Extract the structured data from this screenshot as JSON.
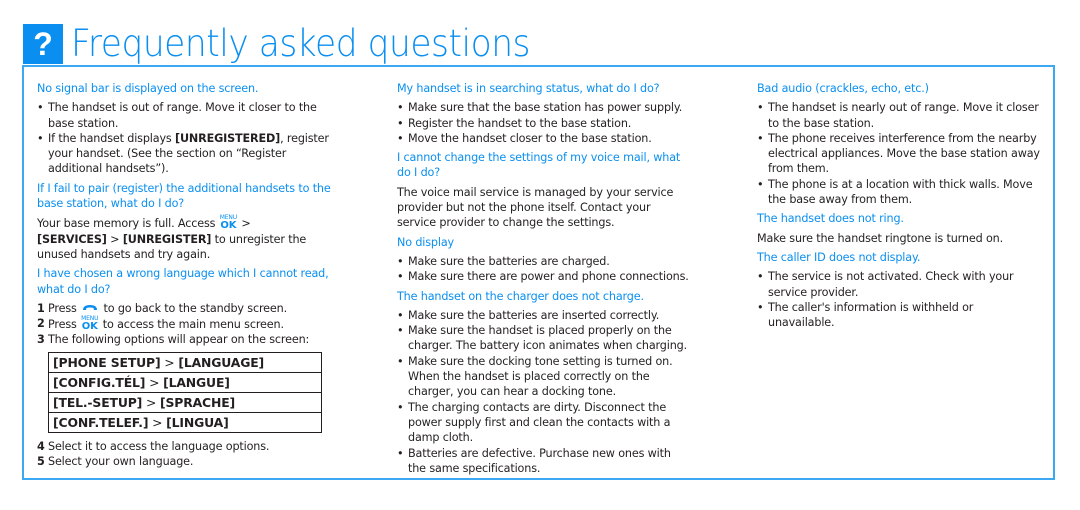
{
  "header": {
    "icon": "question-mark-icon",
    "icon_glyph": "?",
    "title": "Frequently asked questions",
    "accent_color": "#0a8ff0"
  },
  "col1": {
    "q1": {
      "question": "No signal bar is displayed on the screen.",
      "bullets": [
        "The handset is out of range. Move it closer to the base station.",
        {
          "pre": "If the handset displays ",
          "bold": "[UNREGISTERED]",
          "post": ", register your handset. (See the section on “Register additional handsets”)."
        }
      ]
    },
    "q2": {
      "question": "If I fail to pair (register) the additional handsets to the base station, what do I do?",
      "answer_pre": "Your base memory is full. Access ",
      "menu_top": "MENU",
      "menu_ok": "OK",
      "gt1": " > ",
      "bold1": "[SERVICES]",
      "gt2": " > ",
      "bold2": "[UNREGISTER]",
      "answer_post": " to unregister the unused handsets and try again."
    },
    "q3": {
      "question": "I have chosen a wrong language which I cannot read, what do I do?",
      "steps": [
        {
          "num": "1",
          "pre": "Press ",
          "icon": "end-call-icon",
          "post": " to go back to the standby screen."
        },
        {
          "num": "2",
          "pre": "Press ",
          "icon": "menu-ok-icon",
          "post": " to access the main menu screen."
        },
        {
          "num": "3",
          "text": "The following options will appear on the screen:"
        }
      ],
      "options": [
        {
          "a": "[PHONE SETUP]",
          "sep": " > ",
          "b": "[LANGUAGE]"
        },
        {
          "a": "[CONFIG.TÉL]",
          "sep": " > ",
          "b": "[LANGUE]"
        },
        {
          "a": "[TEL.-SETUP]",
          "sep": " > ",
          "b": "[SPRACHE]"
        },
        {
          "a": "[CONF.TELEF.]",
          "sep": " > ",
          "b": "[LINGUA]"
        }
      ],
      "steps_after": [
        {
          "num": "4",
          "text": "Select it to access the language options."
        },
        {
          "num": "5",
          "text": "Select your own language."
        }
      ]
    }
  },
  "col2": {
    "q1": {
      "question": "My handset is in searching status, what do I do?",
      "bullets": [
        "Make sure that the base station has power supply.",
        "Register the handset to the base station.",
        "Move the handset closer to the base station."
      ]
    },
    "q2": {
      "question": "I cannot change the settings of my voice mail, what do I do?",
      "answer": "The voice mail service is managed by your service provider but not the phone itself. Contact your service provider to change the settings."
    },
    "q3": {
      "question": "No display",
      "bullets": [
        "Make sure the batteries are charged.",
        "Make sure there are power and phone connections."
      ]
    },
    "q4": {
      "question": "The handset on the charger does not charge.",
      "bullets": [
        "Make sure the batteries are inserted correctly.",
        "Make sure the handset is placed properly on the charger. The battery icon animates when charging.",
        "Make sure the docking tone setting is turned on. When the handset is placed correctly on the charger, you can hear a docking tone.",
        "The charging contacts are dirty. Disconnect the power supply first and clean the contacts with a damp cloth.",
        "Batteries are defective. Purchase new ones with the same specifications."
      ]
    }
  },
  "col3": {
    "q1": {
      "question": "Bad audio (crackles, echo, etc.)",
      "bullets": [
        "The handset is nearly out of range. Move it closer to the base station.",
        "The phone receives interference from the nearby electrical appliances. Move the base station away from them.",
        "The phone is at a location with thick walls. Move the base away from them."
      ]
    },
    "q2": {
      "question": "The handset does not ring.",
      "answer": "Make sure the handset ringtone is turned on."
    },
    "q3": {
      "question": "The caller ID does not display.",
      "bullets": [
        "The service is not activated. Check with your service provider.",
        "The caller's information is withheld or unavailable."
      ]
    }
  }
}
